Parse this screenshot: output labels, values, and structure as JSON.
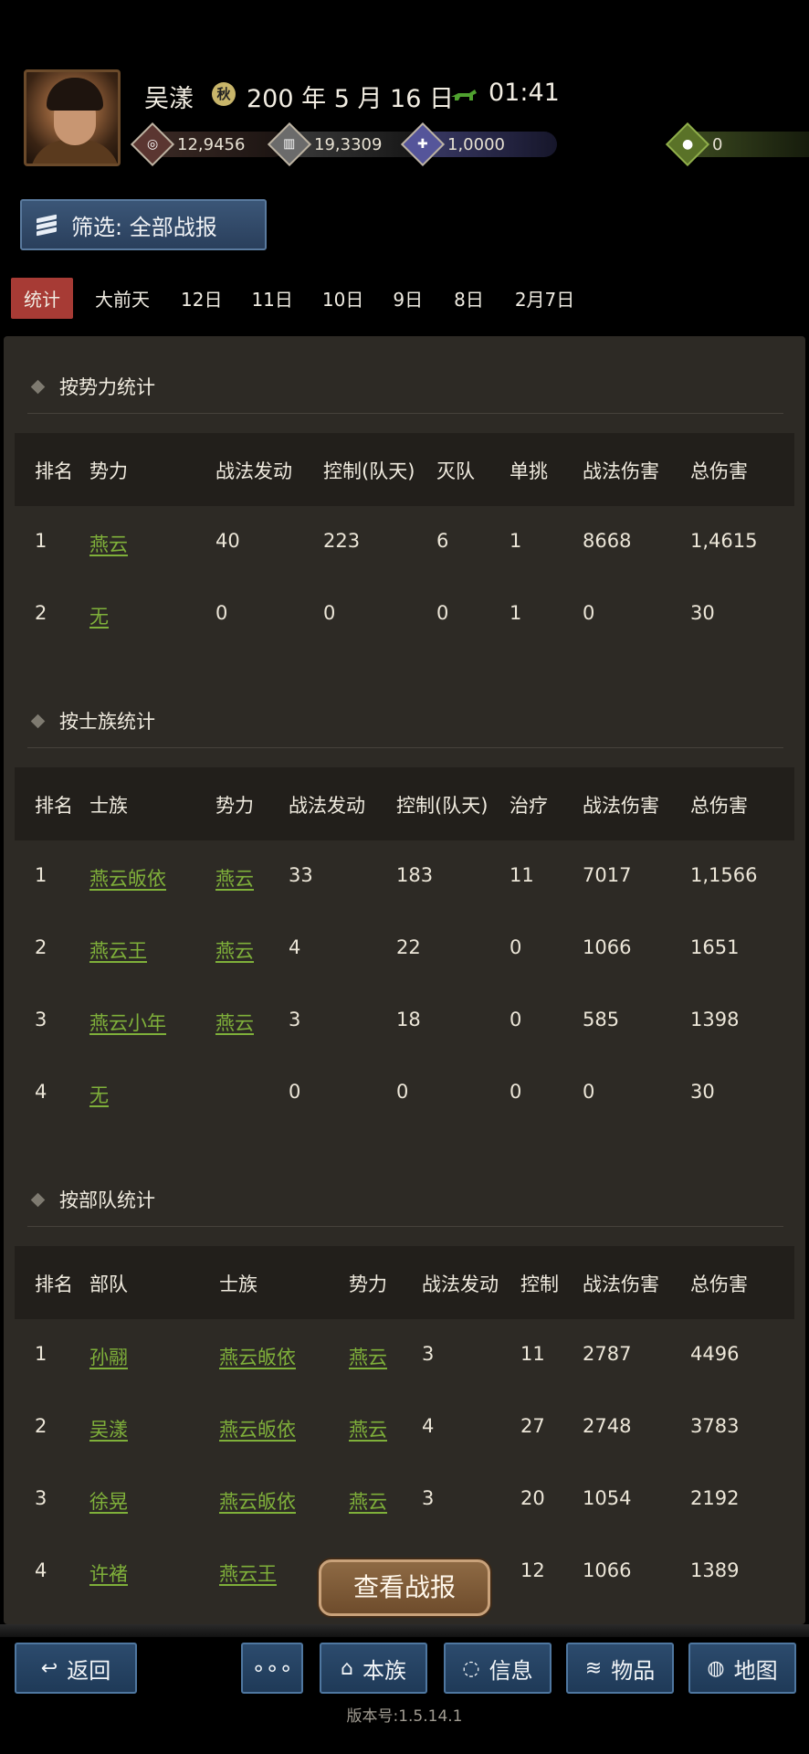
{
  "header": {
    "player_name": "吴漾",
    "season_icon": "season-badge-icon",
    "season_glyph": "秋",
    "date": "200 年 5 月 16 日",
    "time": "01:41",
    "resources": {
      "copper": "12,9456",
      "wood": "19,3309",
      "iron": "1,0000",
      "food": "0"
    }
  },
  "filter": {
    "label": "筛选: 全部战报"
  },
  "tabs": [
    "统计",
    "大前天",
    "12日",
    "11日",
    "10日",
    "9日",
    "8日",
    "2月7日"
  ],
  "force_stats": {
    "title": "按势力统计",
    "headers": [
      "排名",
      "势力",
      "战法发动",
      "控制(队天)",
      "灭队",
      "单挑",
      "战法伤害",
      "总伤害"
    ],
    "rows": [
      [
        "1",
        "燕云",
        "40",
        "223",
        "6",
        "1",
        "8668",
        "1,4615"
      ],
      [
        "2",
        "无",
        "0",
        "0",
        "0",
        "1",
        "0",
        "30"
      ]
    ]
  },
  "clan_stats": {
    "title": "按士族统计",
    "headers": [
      "排名",
      "士族",
      "势力",
      "战法发动",
      "控制(队天)",
      "治疗",
      "战法伤害",
      "总伤害"
    ],
    "rows": [
      [
        "1",
        "燕云皈依",
        "燕云",
        "33",
        "183",
        "11",
        "7017",
        "1,1566"
      ],
      [
        "2",
        "燕云王",
        "燕云",
        "4",
        "22",
        "0",
        "1066",
        "1651"
      ],
      [
        "3",
        "燕云小年",
        "燕云",
        "3",
        "18",
        "0",
        "585",
        "1398"
      ],
      [
        "4",
        "无",
        "",
        "0",
        "0",
        "0",
        "0",
        "30"
      ]
    ]
  },
  "troop_stats": {
    "title": "按部队统计",
    "headers": [
      "排名",
      "部队",
      "士族",
      "势力",
      "战法发动",
      "控制",
      "战法伤害",
      "总伤害"
    ],
    "rows": [
      [
        "1",
        "孙翮",
        "燕云皈依",
        "燕云",
        "3",
        "11",
        "2787",
        "4496"
      ],
      [
        "2",
        "吴漾",
        "燕云皈依",
        "燕云",
        "4",
        "27",
        "2748",
        "3783"
      ],
      [
        "3",
        "徐晃",
        "燕云皈依",
        "燕云",
        "3",
        "20",
        "1054",
        "2192"
      ],
      [
        "4",
        "许褚",
        "燕云王",
        "",
        "",
        "12",
        "1066",
        "1389"
      ]
    ]
  },
  "view_report": "查看战报",
  "bottom_nav": {
    "back": "返回",
    "more": "∘∘∘",
    "clan": "本族",
    "info": "信息",
    "items": "物品",
    "map": "地图"
  },
  "version": "版本号:1.5.14.1"
}
